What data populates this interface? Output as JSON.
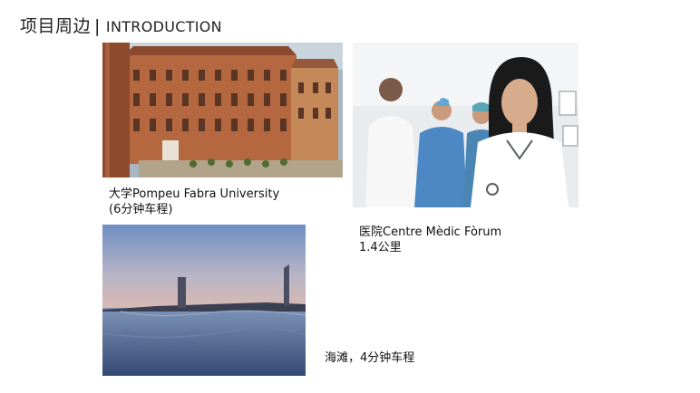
{
  "header": {
    "title_cn": "项目周边",
    "separator": "|",
    "title_en": "INTRODUCTION"
  },
  "items": [
    {
      "caption_line1": "大学Pompeu Fabra University",
      "caption_line2": "(6分钟车程)"
    },
    {
      "caption_line1": "医院Centre Mèdic Fòrum",
      "caption_line2": "1.4公里"
    },
    {
      "caption_line1": "海滩，4分钟车程"
    }
  ]
}
